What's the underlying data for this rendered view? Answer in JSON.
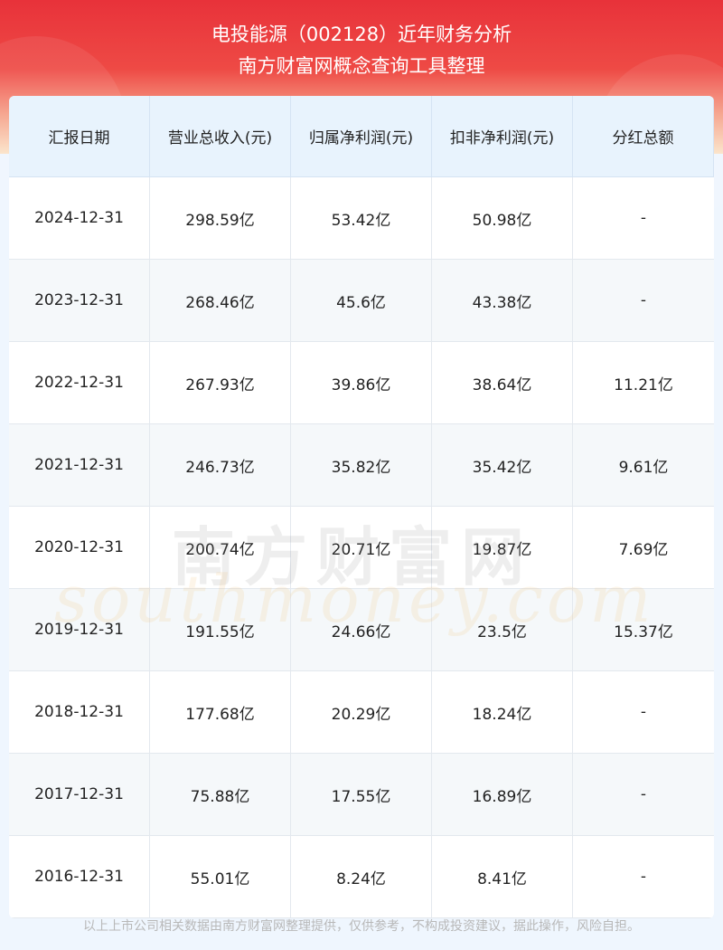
{
  "header": {
    "title": "电投能源（002128）近年财务分析",
    "subtitle": "南方财富网概念查询工具整理"
  },
  "table": {
    "columns": [
      "汇报日期",
      "营业总收入(元)",
      "归属净利润(元)",
      "扣非净利润(元)",
      "分红总额"
    ],
    "rows": [
      [
        "2024-12-31",
        "298.59亿",
        "53.42亿",
        "50.98亿",
        "-"
      ],
      [
        "2023-12-31",
        "268.46亿",
        "45.6亿",
        "43.38亿",
        "-"
      ],
      [
        "2022-12-31",
        "267.93亿",
        "39.86亿",
        "38.64亿",
        "11.21亿"
      ],
      [
        "2021-12-31",
        "246.73亿",
        "35.82亿",
        "35.42亿",
        "9.61亿"
      ],
      [
        "2020-12-31",
        "200.74亿",
        "20.71亿",
        "19.87亿",
        "7.69亿"
      ],
      [
        "2019-12-31",
        "191.55亿",
        "24.66亿",
        "23.5亿",
        "15.37亿"
      ],
      [
        "2018-12-31",
        "177.68亿",
        "20.29亿",
        "18.24亿",
        "-"
      ],
      [
        "2017-12-31",
        "75.88亿",
        "17.55亿",
        "16.89亿",
        "-"
      ],
      [
        "2016-12-31",
        "55.01亿",
        "8.24亿",
        "8.41亿",
        "-"
      ]
    ]
  },
  "watermark": {
    "cn": "南方财富网",
    "en": "southmoney.com"
  },
  "footer": "以上上市公司相关数据由南方财富网整理提供，仅供参考，不构成投资建议，据此操作，风险自担。"
}
